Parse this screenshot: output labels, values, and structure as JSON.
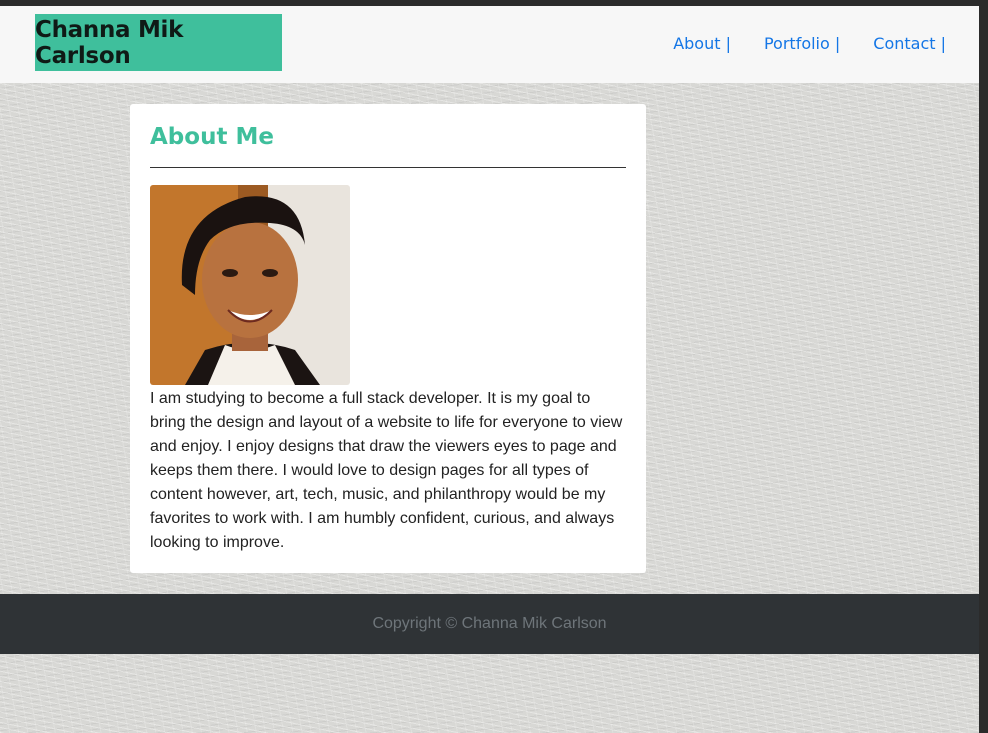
{
  "header": {
    "brand": "Channa Mik Carlson",
    "nav": [
      {
        "label": "About |"
      },
      {
        "label": "Portfolio |"
      },
      {
        "label": "Contact |"
      }
    ]
  },
  "about": {
    "title": "About Me",
    "bio": "I am studying to become a full stack developer. It is my goal to bring the design and layout of a website to life for everyone to view and enjoy. I enjoy designs that draw the viewers eyes to page and keeps them there. I would love to design pages for all types of content however, art, tech, music, and philanthropy would be my favorites to work with. I am humbly confident, curious, and always looking to improve."
  },
  "footer": {
    "copyright": "Copyright © Channa Mik Carlson"
  },
  "colors": {
    "accent": "#3fbf9c",
    "link": "#1476e6",
    "footer_bg": "#2f3336"
  }
}
